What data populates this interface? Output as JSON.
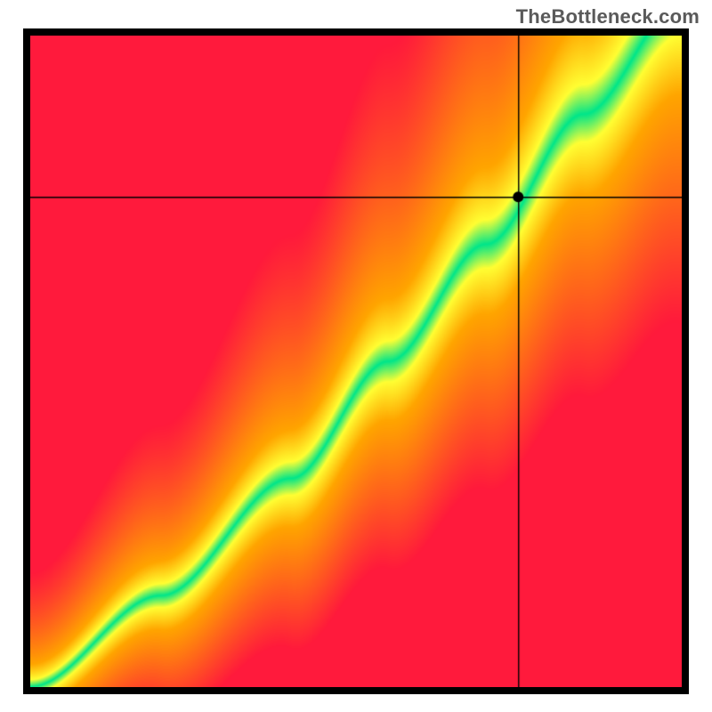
{
  "watermark": "TheBottleneck.com",
  "chart_data": {
    "type": "heatmap",
    "title": "",
    "xlabel": "",
    "ylabel": "",
    "xlim": [
      0,
      1
    ],
    "ylim": [
      0,
      1
    ],
    "color_scale": {
      "low": "#ff1a3c",
      "mid_low": "#ffa500",
      "mid": "#ffff33",
      "good": "#00e68a",
      "best": "#00cc88"
    },
    "ridge": {
      "description": "diagonal optimal band through a heatmap; green where bottleneck is minimal",
      "control_points_norm": [
        {
          "x": 0.0,
          "y": 0.0
        },
        {
          "x": 0.2,
          "y": 0.14
        },
        {
          "x": 0.4,
          "y": 0.32
        },
        {
          "x": 0.55,
          "y": 0.5
        },
        {
          "x": 0.7,
          "y": 0.68
        },
        {
          "x": 0.85,
          "y": 0.88
        },
        {
          "x": 1.0,
          "y": 1.05
        }
      ],
      "band_halfwidth_norm": 0.055
    },
    "crosshair": {
      "x_norm": 0.75,
      "y_norm": 0.752
    },
    "marker": {
      "x_norm": 0.75,
      "y_norm": 0.752,
      "radius_px": 6
    }
  }
}
